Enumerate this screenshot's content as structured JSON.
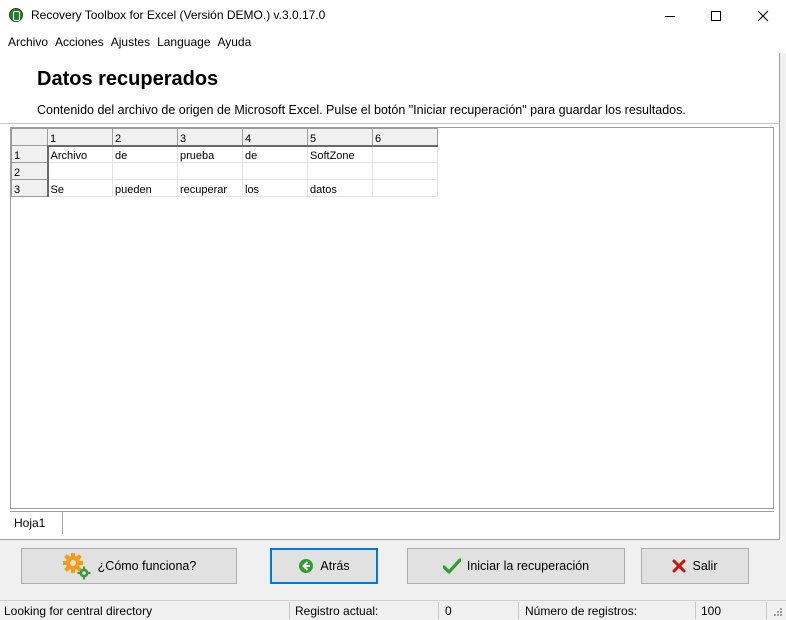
{
  "window": {
    "title": "Recovery Toolbox for Excel (Versión DEMO.) v.3.0.17.0",
    "minimize_glyph": "—",
    "maximize_glyph": "☐",
    "close_glyph": "✕"
  },
  "menu": {
    "items": [
      "Archivo",
      "Acciones",
      "Ajustes",
      "Language",
      "Ayuda"
    ]
  },
  "page": {
    "title": "Datos recuperados",
    "description": "Contenido del archivo de origen de Microsoft Excel. Pulse el botón \"Iniciar recuperación\" para guardar los resultados."
  },
  "grid": {
    "column_headers": [
      "1",
      "2",
      "3",
      "4",
      "5",
      "6"
    ],
    "rows": [
      {
        "header": "1",
        "cells": [
          "Archivo",
          "de",
          "prueba",
          "de",
          "SoftZone",
          ""
        ]
      },
      {
        "header": "2",
        "cells": [
          "",
          "",
          "",
          "",
          "",
          ""
        ]
      },
      {
        "header": "3",
        "cells": [
          "Se",
          "pueden",
          "recuperar",
          "los",
          "datos",
          ""
        ]
      }
    ]
  },
  "sheets": {
    "tabs": [
      "Hoja1"
    ]
  },
  "buttons": {
    "how_it_works": "¿Cómo funciona?",
    "back": "Atrás",
    "start_recovery": "Iniciar la recuperación",
    "exit": "Salir"
  },
  "status": {
    "message": "Looking for central directory",
    "current_record_label": "Registro actual:",
    "current_record_value": "0",
    "record_count_label": "Número de registros:",
    "record_count_value": "100"
  },
  "colors": {
    "accent_blue": "#0078d7",
    "check_green": "#2e9e2e",
    "exit_red": "#cc1111",
    "gear_orange": "#f39c12"
  }
}
